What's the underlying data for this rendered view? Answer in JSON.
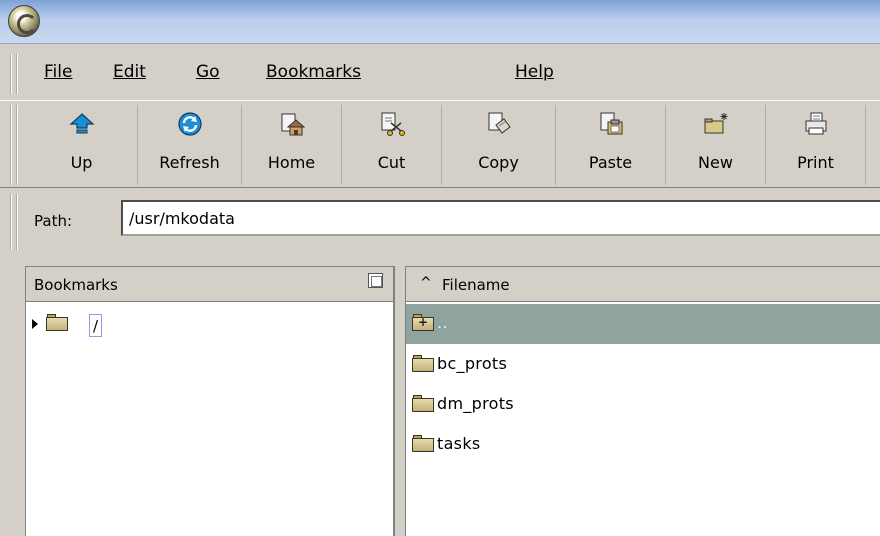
{
  "menu": {
    "file": "File",
    "edit": "Edit",
    "go": "Go",
    "bookmarks": "Bookmarks",
    "help": "Help"
  },
  "toolbar": {
    "buttons": [
      {
        "label": "Up",
        "icon": "up-arrow-icon"
      },
      {
        "label": "Refresh",
        "icon": "refresh-icon"
      },
      {
        "label": "Home",
        "icon": "home-icon"
      },
      {
        "label": "Cut",
        "icon": "scissors-icon"
      },
      {
        "label": "Copy",
        "icon": "copy-icon"
      },
      {
        "label": "Paste",
        "icon": "paste-icon"
      },
      {
        "label": "New",
        "icon": "new-folder-icon"
      },
      {
        "label": "Print",
        "icon": "printer-icon"
      }
    ]
  },
  "path": {
    "label": "Path:",
    "value": "/usr/mkodata"
  },
  "bookmarks_panel": {
    "title": "Bookmarks",
    "items": [
      {
        "label": "/"
      }
    ]
  },
  "file_list": {
    "column": "Filename",
    "sort": "ascending",
    "rows": [
      {
        "name": "..",
        "selected": true
      },
      {
        "name": "bc_prots",
        "selected": false
      },
      {
        "name": "dm_prots",
        "selected": false
      },
      {
        "name": "tasks",
        "selected": false
      }
    ]
  },
  "colors": {
    "titlebar": "#7da2d8",
    "selection": "#8fa39f",
    "chrome": "#d4d0c8"
  }
}
